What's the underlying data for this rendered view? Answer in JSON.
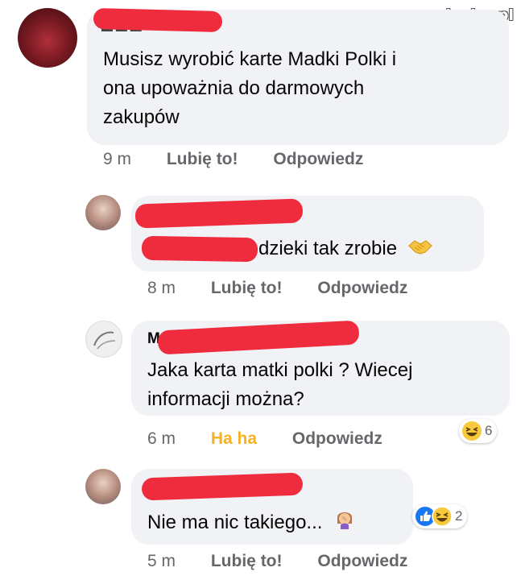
{
  "watermark": "www.wiocha.pl",
  "comments": [
    {
      "text_lines": [
        "Musisz wyrobić karte Madki Polki i",
        "ona upoważnia do darmowych",
        "zakupów"
      ],
      "time": "9 m",
      "action_like": "Lubię to!",
      "action_reply": "Odpowiedz"
    },
    {
      "text": "dzieki tak zrobie",
      "emoji": "handshake-emoji",
      "time": "8 m",
      "action_like": "Lubię to!",
      "action_reply": "Odpowiedz"
    },
    {
      "name_partial": "M",
      "text_lines": [
        "Jaka karta matki polki ? Wiecej",
        "informacji można?"
      ],
      "time": "6 m",
      "action_like": "Ha ha",
      "action_reply": "Odpowiedz",
      "reaction_count": "6",
      "reaction_icons": [
        "haha-icon"
      ]
    },
    {
      "text": "Nie ma nic takiego...",
      "emoji": "facepalm-emoji",
      "time": "5 m",
      "action_like": "Lubię to!",
      "action_reply": "Odpowiedz",
      "reaction_count": "2",
      "reaction_icons": [
        "like-icon",
        "haha-icon"
      ]
    }
  ],
  "colors": {
    "bubble": "#f0f2f5",
    "redaction": "#ef2b3e",
    "meta_text": "#65676b",
    "haha_active": "#f7b125",
    "like_blue": "#1877f2"
  }
}
